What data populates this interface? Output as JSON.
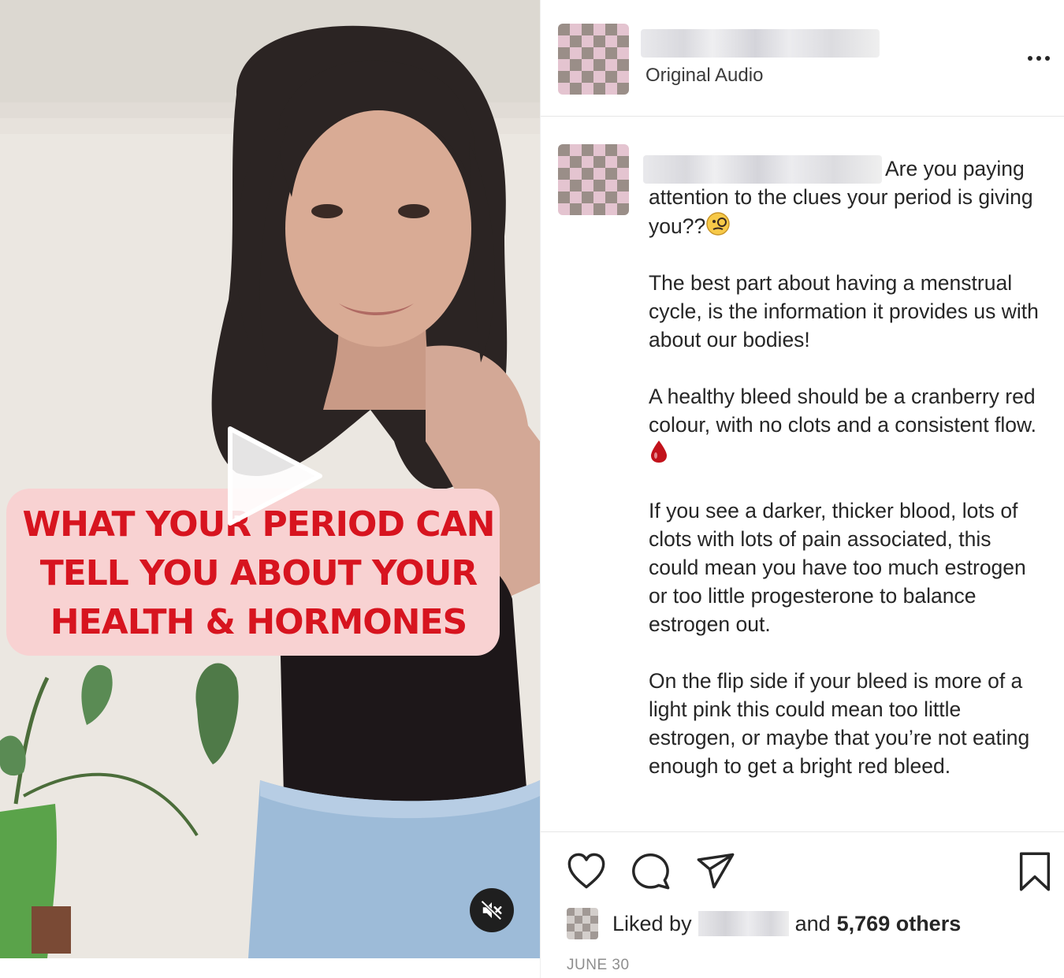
{
  "post": {
    "media": {
      "overlay_lines": [
        "WHAT YOUR PERIOD CAN",
        "TELL YOU ABOUT YOUR",
        "HEALTH & HORMONES"
      ],
      "play_icon": "play-icon",
      "mute_icon": "muted-speaker-icon"
    },
    "header": {
      "subtitle": "Original Audio",
      "more_icon": "more-options-icon"
    },
    "caption": {
      "paragraphs": [
        "Are you paying attention to the clues your period is giving you??",
        "The best part about having a menstrual cycle, is the information it provides us with about our bodies!",
        "A healthy bleed should be a cranberry red colour, with no clots and a consistent flow.",
        "If you see a darker, thicker blood, lots of clots with lots of pain associated, this could mean you have too much estrogen or too little progesterone to balance estrogen out.",
        "On the flip side if your bleed is more of a light pink this could mean too little estrogen, or maybe that you’re not eating enough to get a bright red bleed."
      ],
      "emojis": [
        "monocle-face-icon",
        "drop-of-blood-icon"
      ]
    },
    "actions": {
      "icons": [
        "heart-icon",
        "comment-icon",
        "share-icon",
        "bookmark-icon"
      ]
    },
    "likes": {
      "prefix": "Liked by",
      "middle": "and",
      "count": "5,769 others"
    },
    "date": "JUNE 30",
    "colors": {
      "overlay_text": "#d7141f",
      "overlay_background": "#f8d2d2",
      "text": "#262626",
      "muted": "#8e8e8e"
    }
  }
}
